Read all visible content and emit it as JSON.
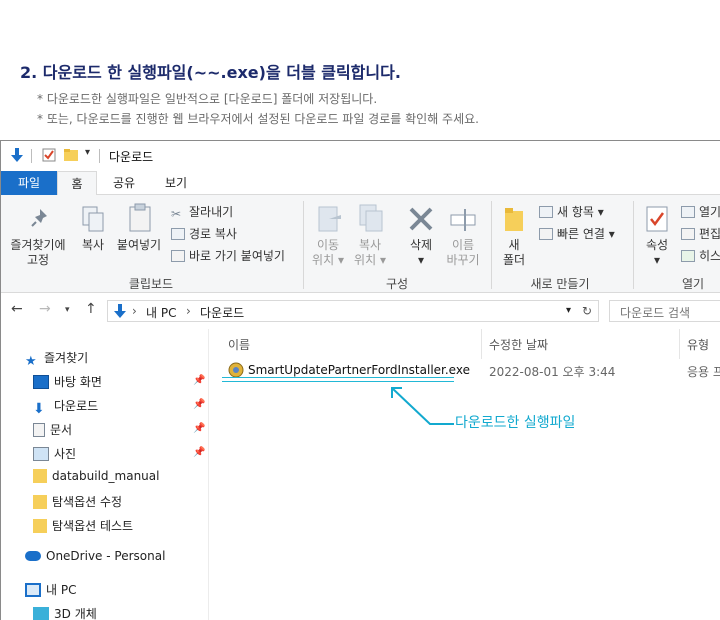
{
  "doc": {
    "heading": "2. 다운로드 한 실행파일(~~.exe)을 더블 클릭합니다.",
    "note1": "* 다운로드한 실행파일은 일반적으로 [다운로드] 폴더에 저장됩니다.",
    "note2": "* 또는, 다운로드를 진행한 웹 브라우저에서 설정된 다운로드 파일 경로를 확인해 주세요."
  },
  "window": {
    "title": "다운로드",
    "tabs": [
      "파일",
      "홈",
      "공유",
      "보기"
    ],
    "ribbon": {
      "clipboard": {
        "pin_label_1": "즐겨찾기에",
        "pin_label_2": "고정",
        "copy": "복사",
        "paste": "붙여넣기",
        "cut": "잘라내기",
        "copy_path": "경로 복사",
        "paste_shortcut": "바로 가기 붙여넣기",
        "group": "클립보드"
      },
      "organize": {
        "move_1": "이동",
        "move_2": "위치",
        "copyto_1": "복사",
        "copyto_2": "위치",
        "delete": "삭제",
        "rename_1": "이름",
        "rename_2": "바꾸기",
        "group": "구성"
      },
      "new": {
        "folder_1": "새",
        "folder_2": "폴더",
        "new_item": "새 항목",
        "easy_access": "빠른 연결",
        "group": "새로 만들기"
      },
      "open": {
        "properties": "속성",
        "open": "열기",
        "edit": "편집",
        "history": "히스",
        "group": "열기"
      }
    },
    "address": {
      "crumb1": "내 PC",
      "crumb2": "다운로드",
      "search_placeholder": "다운로드 검색"
    },
    "nav": {
      "quick_access": "즐겨찾기",
      "items": [
        "바탕 화면",
        "다운로드",
        "문서",
        "사진",
        "databuild_manual",
        "탐색옵션 수정",
        "탐색옵션 테스트"
      ],
      "onedrive": "OneDrive - Personal",
      "this_pc": "내 PC",
      "objects_3d": "3D 개체"
    },
    "columns": {
      "name": "이름",
      "modified": "수정한 날짜",
      "type": "유형"
    },
    "file": {
      "name": "SmartUpdatePartnerFordInstaller.exe",
      "modified": "2022-08-01 오후 3:44",
      "type": "응용 프"
    }
  },
  "annotation": {
    "label": "다운로드한 실행파일"
  },
  "colors": {
    "heading": "#1c2a6b",
    "accent": "#1a6fc9",
    "callout": "#12a9cf"
  }
}
